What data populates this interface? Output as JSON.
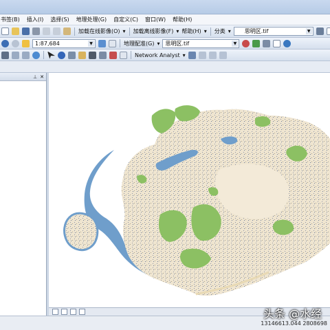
{
  "menu": {
    "items": [
      "书签(B)",
      "插入(I)",
      "选择(S)",
      "地理处理(G)",
      "自定义(C)",
      "窗口(W)",
      "帮助(H)"
    ]
  },
  "toolbar1": {
    "online_imagery_label": "加载在线影像(O)",
    "offline_imagery_label": "加载离线影像(F)",
    "help_label": "帮助(H)",
    "classify_label": "分类",
    "layer_select": "思明区.tif"
  },
  "toolbar2": {
    "scale_value": "1:87,684",
    "georef_label": "地理配准(G)",
    "georef_layer": "思明区.tif"
  },
  "toolbar3": {
    "network_analyst_label": "Network Analyst"
  },
  "status": {
    "coordinates": "13146613.044  2808698"
  },
  "watermark": {
    "text": "头条 @水经"
  },
  "colors": {
    "water": "#6f9ecb",
    "urban": "#efe7d4",
    "green": "#8cc063",
    "toolbar": "#d6e0ee"
  }
}
